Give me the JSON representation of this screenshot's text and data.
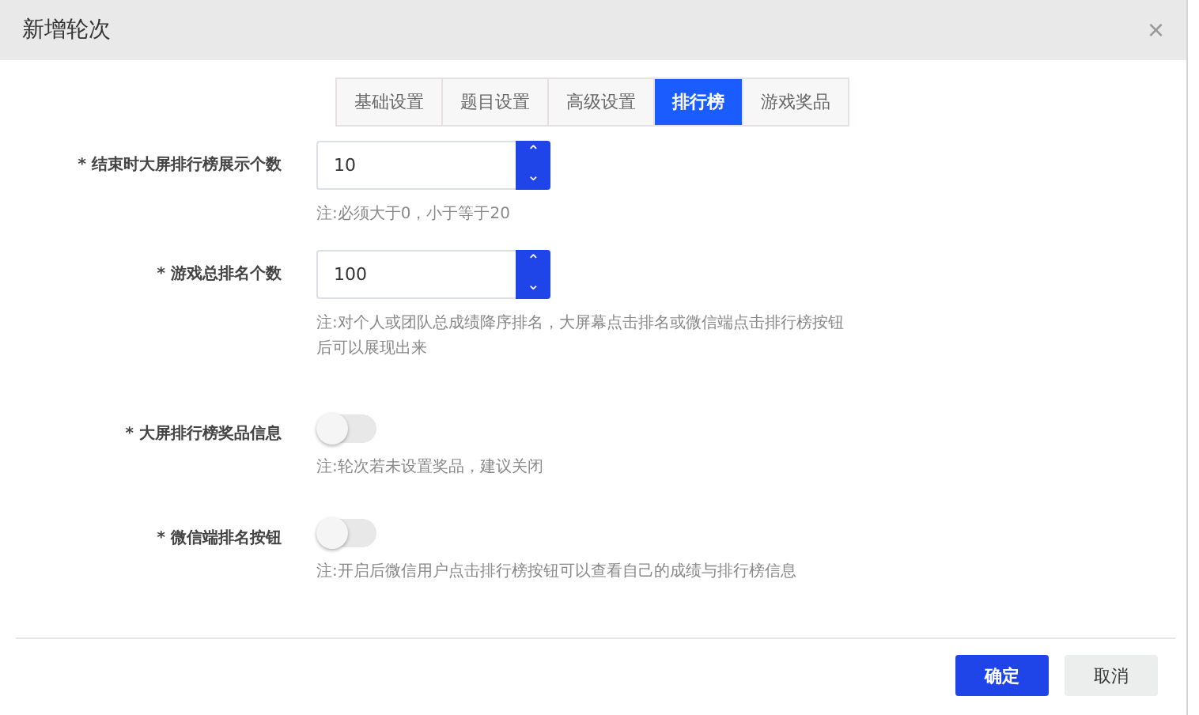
{
  "dialog": {
    "title": "新增轮次",
    "close": "×"
  },
  "tabs": [
    {
      "label": "基础设置",
      "selected": false
    },
    {
      "label": "题目设置",
      "selected": false
    },
    {
      "label": "高级设置",
      "selected": false
    },
    {
      "label": "排行榜",
      "selected": true
    },
    {
      "label": "游戏奖品",
      "selected": false
    }
  ],
  "fields": [
    {
      "kind": "number",
      "label": "* 结束时大屏排行榜展示个数",
      "value": "10",
      "up": "⌃",
      "down": "⌄",
      "note": "注:必须大于0，小于等于20"
    },
    {
      "kind": "number",
      "label": "* 游戏总排名个数",
      "value": "100",
      "up": "⌃",
      "down": "⌄",
      "note": "注:对个人或团队总成绩降序排名，大屏幕点击排名或微信端点击排行榜按钮后可以展现出来"
    },
    {
      "kind": "switch",
      "label": "* 大屏排行榜奖品信息",
      "on": false,
      "note": "注:轮次若未设置奖品，建议关闭"
    },
    {
      "kind": "switch",
      "label": "* 微信端排名按钮",
      "on": false,
      "note": "注:开启后微信用户点击排行榜按钮可以查看自己的成绩与排行榜信息"
    }
  ],
  "buttons": [
    {
      "label": "确定",
      "kind": "primary"
    },
    {
      "label": "取消",
      "kind": "secondary"
    }
  ]
}
